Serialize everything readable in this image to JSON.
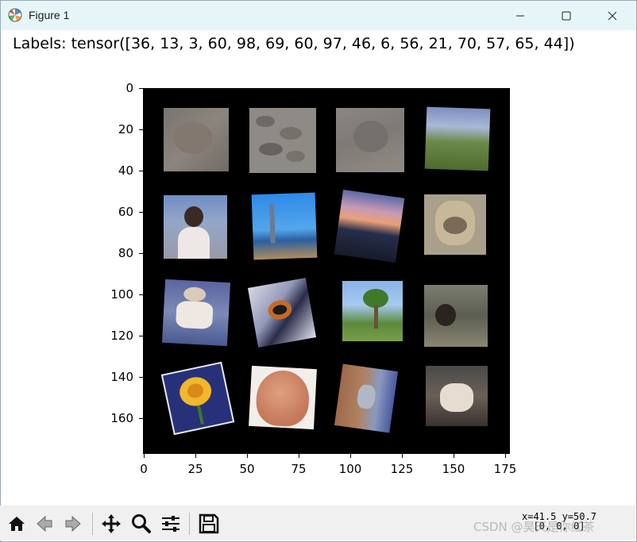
{
  "window": {
    "title": "Figure 1"
  },
  "figure": {
    "suptitle": "Labels: tensor([36, 13,  3, 60, 98, 69, 60, 97, 46,  6, 56, 21, 70, 57, 65, 44])",
    "y_ticks": [
      "0",
      "20",
      "40",
      "60",
      "80",
      "100",
      "120",
      "140",
      "160"
    ],
    "x_ticks": [
      "0",
      "25",
      "50",
      "75",
      "100",
      "125",
      "150",
      "175"
    ]
  },
  "toolbar": {
    "coord_line1": "x=41.5 y=50.7",
    "coord_line2": "[0, 0, 0]",
    "icons": [
      "home-icon",
      "back-icon",
      "forward-icon",
      "pan-icon",
      "zoom-icon",
      "configure-subplots-icon",
      "save-icon"
    ]
  },
  "watermark": "CSDN @昊天是你红茶",
  "colors": {
    "titlebar": "#e6f6f8",
    "toolbar": "#f0f0f0",
    "axes_bg": "#000000"
  }
}
